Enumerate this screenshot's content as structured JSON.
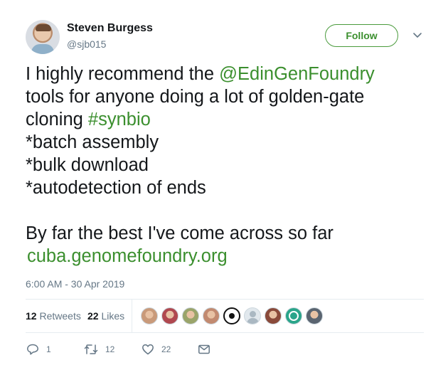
{
  "author": {
    "name": "Steven Burgess",
    "handle": "@sjb015"
  },
  "follow_label": "Follow",
  "tweet": {
    "lines": [
      [
        {
          "t": "I highly recommend the "
        },
        {
          "t": "@EdinGenFoundry",
          "link": true
        }
      ],
      [
        {
          "t": "tools for anyone doing a lot of golden-gate"
        }
      ],
      [
        {
          "t": "cloning "
        },
        {
          "t": "#synbio",
          "link": true
        }
      ],
      [
        {
          "t": "*batch assembly"
        }
      ],
      [
        {
          "t": "*bulk download"
        }
      ],
      [
        {
          "t": "*autodetection of ends"
        }
      ],
      [],
      [
        {
          "t": "By far the best I've come across so far"
        }
      ]
    ],
    "url": "cuba.genomefoundry.org"
  },
  "timestamp": "6:00 AM - 30 Apr 2019",
  "stats": {
    "retweets_count": "12",
    "retweets_label": "Retweets",
    "likes_count": "22",
    "likes_label": "Likes"
  },
  "liker_avatars": [
    {
      "icon": "user-avatar-1",
      "color": "#c99a7a"
    },
    {
      "icon": "user-avatar-2",
      "color": "#b0484f"
    },
    {
      "icon": "user-avatar-3",
      "color": "#9aa46a"
    },
    {
      "icon": "user-avatar-4",
      "color": "#c28a70"
    },
    {
      "icon": "target-avatar",
      "color": "#111111"
    },
    {
      "icon": "default-avatar",
      "color": "#aab8c2"
    },
    {
      "icon": "user-avatar-7",
      "color": "#8a4a3a"
    },
    {
      "icon": "egf-logo-avatar",
      "color": "#2aa58a"
    },
    {
      "icon": "user-avatar-9",
      "color": "#5a6470"
    }
  ],
  "actions": {
    "replies": "1",
    "retweets": "12",
    "likes": "22"
  },
  "colors": {
    "accent": "#3b8f2e",
    "muted": "#657786"
  }
}
